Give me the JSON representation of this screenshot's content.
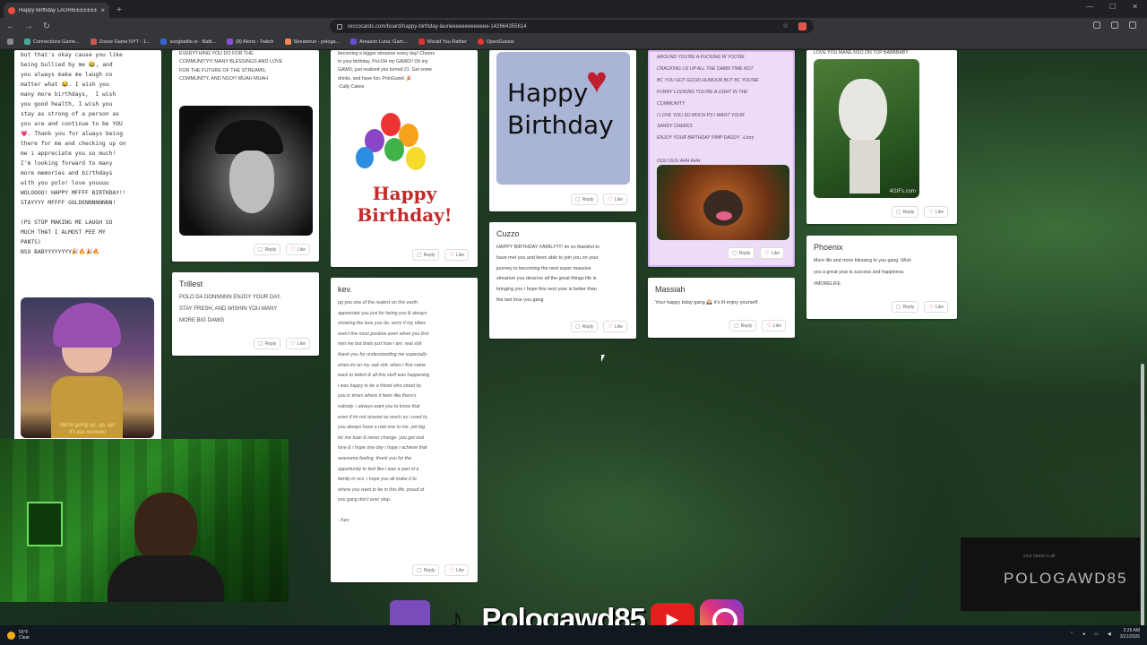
{
  "browser": {
    "tab_title": "Happy Birthday LAURIEEEEEEEE",
    "url": "reccocards.com/board/happy-birthday-laurieeeeeeeeeeeee-142664355614",
    "bookmarks": [
      "Connections Game...",
      "Zoose Game NYT - 1...",
      "songbattle.io - Battl...",
      "(8) Alerts - Twitch",
      "Streamrun - pologa...",
      "Amazon Luna: Gam...",
      "Would You Rather",
      "OpenGuessr"
    ]
  },
  "actions": {
    "reply": "Reply",
    "like": "Like"
  },
  "cards": {
    "c1": {
      "message": "but that's okay cause you like\nbeing bullied by me 😂, and\nyou always make me laugh no\nmatter what 😂. I wish you\nmany more birthdays,  I wish\nyou good health, I wish you\nstay as strong of a person as\nyou are and continue to be YOU\n💗. Thank you for always being\nthere for me and checking up on\nme i appreciate you so much!\nI'm looking forward to many\nmore memories and birthdays\nwith you polo! love youuuu\nWOLOOOO! HAPPY MFFFF BIRTHDAY!!\nSTAYYYY MFFFF GOLDENNNNNNNN!\n\n(PS STOP MAKING ME LAUGH SO\nMUCH THAT I ALMOST PEE MY\nPANTS)\nNSO BABYYYYYYYY🎉🔥🎉🔥",
      "gif_caption": "We're going up, up, up!\nIt's our moment"
    },
    "c2": {
      "message": "EVERYTHING YOU DO FOR THE\nCOMMUNITY!!! MANY BLESSINGS AND LOVE\nFOR THE FUTURE OF THE STREAMS,\nCOMMUNITY, AND NSO!!! MUAH MUAH"
    },
    "c3": {
      "message": "becoming a bigger streamer every day! Cheers\nto your birthday, Pol-OH my GAWD!! Oh my\nGAWD, just realized you turned 21. Get some\ndrinks, and have fun, PoloGawd. 🎉\n-Cally Cakes",
      "img_text": "Happy\nBirthday!"
    },
    "c4": {
      "img_text": "Happy\nBirthday"
    },
    "c5": {
      "message": "AROUND YOU'RE A FUCKING W YOU'RE\nCRACKING US UP ALL THE DAMN TIME NOT\nBC YOU GOT GOOD HUMOUR BUT BC YOU'RE\nFUNNY LOOKING YOU'RE A LIGHT IN THE\nCOMMUNITY\nI LOVE YOU SO MUCH PS I WANT YOUR\nSANDY CHEEKS\nENJOY YOUR BIRTHDAY PIMP DADDY. -Lizzy\n\nOOU OUU AHH AHH."
    },
    "c6": {
      "message": "LOVE YOU MANE NSO ON TOP BABBBABY",
      "img_text": "4GIFs.com"
    },
    "trillest": {
      "name": "Trillest",
      "message": "POLO DA DONNNNN ENJOY YOUR DAY,\nSTAY FRESH, AND WISHIN YOU MANY\nMORE BIG DAWG"
    },
    "kev": {
      "name": "kev.",
      "message": "pg you one of the realest on this earth.\nappreciate you just for being you & always\nshowing the love you do. sorry if my vibes\naren't the most positive even when you first\nmet me but thats just how i am. real shit\nthank you for understanding me especially\nwhen im on my sad shit. when i first came\nback to twitch & all this stuff was happening\ni was happy to be a friend who stood by\nyou in times where it feels like there's\nnobody. i always want you to know that\neven if im not around as much as i used to,\nyou always have a real one in me. yet big\nfor me tuan & never change. you got real\nlove & i hope one day i hope i achieve that\nawesome feeling. thank you for the\nopportunity to feel like i was a part of a\nfamily in ncs. i hope you all make it to\nwhere you want to be in this life. proud of\nyou gang don't ever stop.\n\n- Kev."
    },
    "cuzzo": {
      "name": "Cuzzo",
      "message": "HAPPY BIRTHDAY FAMILY!!!!! im so thankful to\nhave met you and been able to join you on your\njourney to becoming the next super massive\nstreamer you deserve all the great things life is\nbringing you i hope this next year is better than\nthe last love you gang"
    },
    "massiah": {
      "name": "Massiah",
      "message": "Your happy bday gang 🕰️ it's lit enjoy yourself"
    },
    "phoenix": {
      "name": "Phoenix",
      "message": "More life and more blessing to you gang. Wish\nyou a great year is success and happiness.\n#MORELIFE"
    }
  },
  "overlay": {
    "handle": "Pologawd85",
    "brand": "POLOGAWD85",
    "brand_sub": "your future is all"
  },
  "taskbar": {
    "weather": "55°F",
    "weather_sub": "Clear",
    "time": "2:25 AM",
    "date": "3/21/2026"
  }
}
